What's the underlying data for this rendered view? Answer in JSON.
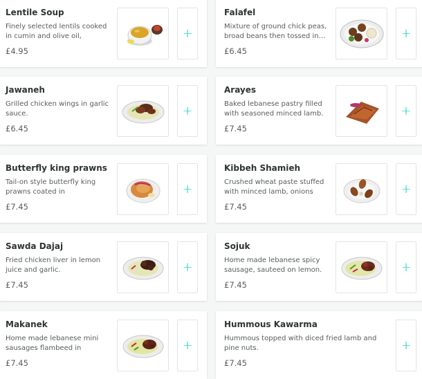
{
  "menu": {
    "items": [
      {
        "name": "Lentile Soup",
        "description": "Finely selected lentils cooked in cumin and olive oil, served…",
        "price": "£4.95",
        "image_icon": "lentil-soup-icon",
        "add_label": "+"
      },
      {
        "name": "Falafel",
        "description": "Mixture of ground chick peas, broad beans then tossed in…",
        "price": "£6.45",
        "image_icon": "falafel-icon",
        "add_label": "+"
      },
      {
        "name": "Jawaneh",
        "description": "Grilled chicken wings in garlic sauce.",
        "price": "£6.45",
        "image_icon": "chicken-wings-icon",
        "add_label": "+"
      },
      {
        "name": "Arayes",
        "description": "Baked lebanese pastry filled with seasoned minced lamb.",
        "price": "£7.45",
        "image_icon": "arayes-icon",
        "add_label": "+"
      },
      {
        "name": "Butterfly king prawns",
        "description": "Tail-on style butterfly king prawns coated in breadcrumbs.",
        "price": "£7.45",
        "image_icon": "prawns-icon",
        "add_label": "+"
      },
      {
        "name": "Kibbeh Shamieh",
        "description": "Crushed wheat paste stuffed with minced lamb, onions an…",
        "price": "£7.45",
        "image_icon": "kibbeh-icon",
        "add_label": "+"
      },
      {
        "name": "Sawda Dajaj",
        "description": "Fried chicken liver in lemon juice and garlic.",
        "price": "£7.45",
        "image_icon": "chicken-liver-icon",
        "add_label": "+"
      },
      {
        "name": "Sojuk",
        "description": "Home made lebanese spicy sausage, sauteed on lemon.",
        "price": "£7.45",
        "image_icon": "sojuk-icon",
        "add_label": "+"
      },
      {
        "name": "Makanek",
        "description": "Home made lebanese mini sausages flambeed in lemon…",
        "price": "£7.45",
        "image_icon": "makanek-icon",
        "add_label": "+"
      },
      {
        "name": "Hummous Kawarma",
        "description": "Hummous topped with diced fried lamb and pine nuts.",
        "price": "£7.45",
        "image_icon": "hummous-icon",
        "add_label": "+"
      }
    ]
  },
  "colors": {
    "accent": "#00ccbc",
    "title": "#2e3333",
    "text": "#585c5c",
    "background": "#f5f6f6"
  }
}
